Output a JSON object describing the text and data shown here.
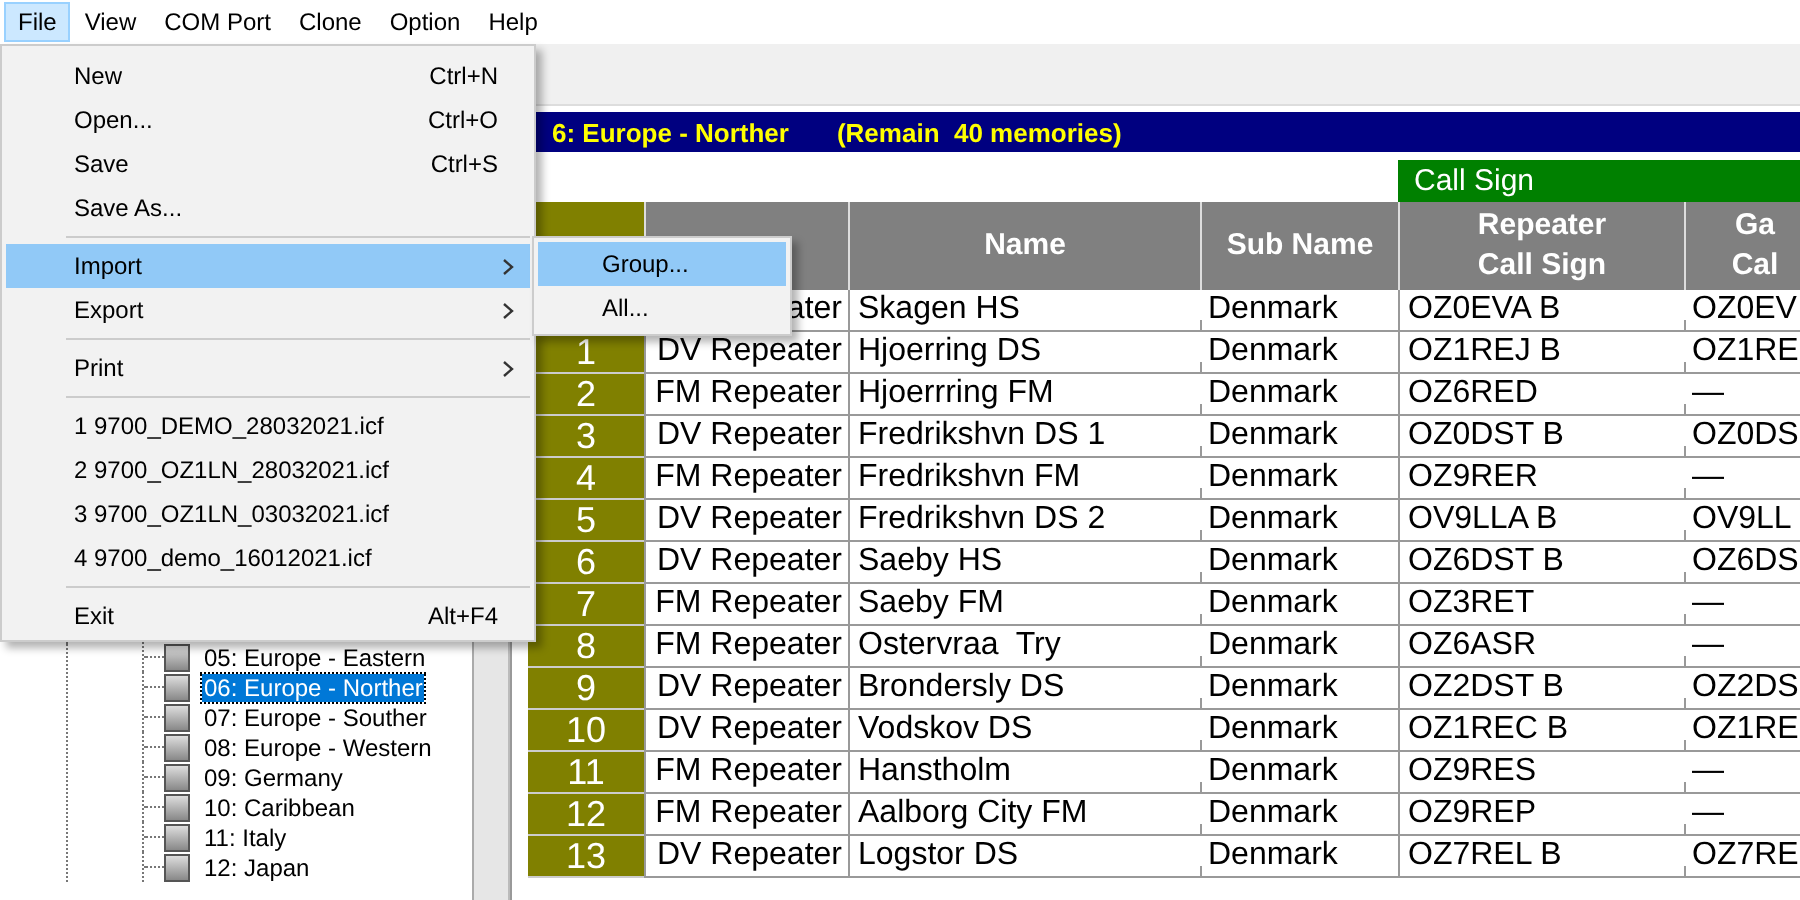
{
  "menu_bar": [
    {
      "label": "File",
      "selected": true
    },
    {
      "label": "View",
      "selected": false
    },
    {
      "label": "COM Port",
      "selected": false
    },
    {
      "label": "Clone",
      "selected": false
    },
    {
      "label": "Option",
      "selected": false
    },
    {
      "label": "Help",
      "selected": false
    }
  ],
  "file_menu": {
    "items": [
      {
        "kind": "item",
        "label": "New",
        "shortcut": "Ctrl+N",
        "has_submenu": false,
        "selected": false
      },
      {
        "kind": "item",
        "label": "Open...",
        "shortcut": "Ctrl+O",
        "has_submenu": false,
        "selected": false
      },
      {
        "kind": "item",
        "label": "Save",
        "shortcut": "Ctrl+S",
        "has_submenu": false,
        "selected": false
      },
      {
        "kind": "item",
        "label": "Save As...",
        "has_submenu": false,
        "selected": false
      },
      {
        "kind": "separator"
      },
      {
        "kind": "item",
        "label": "Import",
        "has_submenu": true,
        "selected": true
      },
      {
        "kind": "item",
        "label": "Export",
        "has_submenu": true,
        "selected": false
      },
      {
        "kind": "separator"
      },
      {
        "kind": "item",
        "label": "Print",
        "has_submenu": true,
        "selected": false
      },
      {
        "kind": "separator"
      },
      {
        "kind": "item",
        "label": "1 9700_DEMO_28032021.icf",
        "has_submenu": false,
        "selected": false
      },
      {
        "kind": "item",
        "label": "2 9700_OZ1LN_28032021.icf",
        "has_submenu": false,
        "selected": false
      },
      {
        "kind": "item",
        "label": "3 9700_OZ1LN_03032021.icf",
        "has_submenu": false,
        "selected": false
      },
      {
        "kind": "item",
        "label": "4 9700_demo_16012021.icf",
        "has_submenu": false,
        "selected": false
      },
      {
        "kind": "separator"
      },
      {
        "kind": "item",
        "label": "Exit",
        "shortcut": "Alt+F4",
        "has_submenu": false,
        "selected": false
      }
    ]
  },
  "submenu": {
    "items": [
      {
        "label": "Group...",
        "selected": true
      },
      {
        "label": "All...",
        "selected": false
      }
    ]
  },
  "banner": {
    "group": "6: Europe - Norther",
    "remain": "(Remain  40 memories)"
  },
  "tree": {
    "items": [
      {
        "label": "05: Europe - Eastern",
        "selected": false
      },
      {
        "label": "06: Europe - Norther",
        "selected": true
      },
      {
        "label": "07: Europe - Souther",
        "selected": false
      },
      {
        "label": "08: Europe - Western",
        "selected": false
      },
      {
        "label": "09: Germany",
        "selected": false
      },
      {
        "label": "10: Caribbean",
        "selected": false
      },
      {
        "label": "11: Italy",
        "selected": false
      },
      {
        "label": "12: Japan",
        "selected": false
      }
    ]
  },
  "table": {
    "group_header": "Call Sign",
    "columns": [
      {
        "lines": [
          "Name"
        ]
      },
      {
        "lines": [
          "Sub Name"
        ]
      },
      {
        "lines": [
          "Repeater",
          "Call Sign"
        ]
      },
      {
        "lines": [
          "Ga",
          "Cal"
        ]
      }
    ],
    "rows": [
      {
        "type": "ater",
        "name": "Skagen HS",
        "sub_name": "Denmark",
        "repeater_call_sign": "OZ0EVA B",
        "column_6": "OZ0EV"
      },
      {
        "number": "1",
        "type": "DV Repeater",
        "name": "Hjoerring DS",
        "sub_name": "Denmark",
        "repeater_call_sign": "OZ1REJ B",
        "column_6": "OZ1RE"
      },
      {
        "number": "2",
        "type": "FM Repeater",
        "name": "Hjoerrring FM",
        "sub_name": "Denmark",
        "repeater_call_sign": "OZ6RED",
        "column_6": "—"
      },
      {
        "number": "3",
        "type": "DV Repeater",
        "name": "Fredrikshvn DS 1",
        "sub_name": "Denmark",
        "repeater_call_sign": "OZ0DST B",
        "column_6": "OZ0DS"
      },
      {
        "number": "4",
        "type": "FM Repeater",
        "name": "Fredrikshvn FM",
        "sub_name": "Denmark",
        "repeater_call_sign": "OZ9RER",
        "column_6": "—"
      },
      {
        "number": "5",
        "type": "DV Repeater",
        "name": "Fredrikshvn DS 2",
        "sub_name": "Denmark",
        "repeater_call_sign": "OV9LLA B",
        "column_6": "OV9LL"
      },
      {
        "number": "6",
        "type": "DV Repeater",
        "name": "Saeby HS",
        "sub_name": "Denmark",
        "repeater_call_sign": "OZ6DST B",
        "column_6": "OZ6DS"
      },
      {
        "number": "7",
        "type": "FM Repeater",
        "name": "Saeby FM",
        "sub_name": "Denmark",
        "repeater_call_sign": "OZ3RET",
        "column_6": "—"
      },
      {
        "number": "8",
        "type": "FM Repeater",
        "name": "Ostervraa  Try",
        "sub_name": "Denmark",
        "repeater_call_sign": "OZ6ASR",
        "column_6": "—"
      },
      {
        "number": "9",
        "type": "DV Repeater",
        "name": "Brondersly DS",
        "sub_name": "Denmark",
        "repeater_call_sign": "OZ2DST B",
        "column_6": "OZ2DS"
      },
      {
        "number": "10",
        "type": "DV Repeater",
        "name": "Vodskov DS",
        "sub_name": "Denmark",
        "repeater_call_sign": "OZ1REC B",
        "column_6": "OZ1RE"
      },
      {
        "number": "11",
        "type": "FM Repeater",
        "name": "Hanstholm",
        "sub_name": "Denmark",
        "repeater_call_sign": "OZ9RES",
        "column_6": "—"
      },
      {
        "number": "12",
        "type": "FM Repeater",
        "name": "Aalborg City FM",
        "sub_name": "Denmark",
        "repeater_call_sign": "OZ9REP",
        "column_6": "—"
      },
      {
        "number": "13",
        "type": "DV Repeater",
        "name": "Logstor DS",
        "sub_name": "Denmark",
        "repeater_call_sign": "OZ7REL B",
        "column_6": "OZ7RE"
      }
    ]
  }
}
